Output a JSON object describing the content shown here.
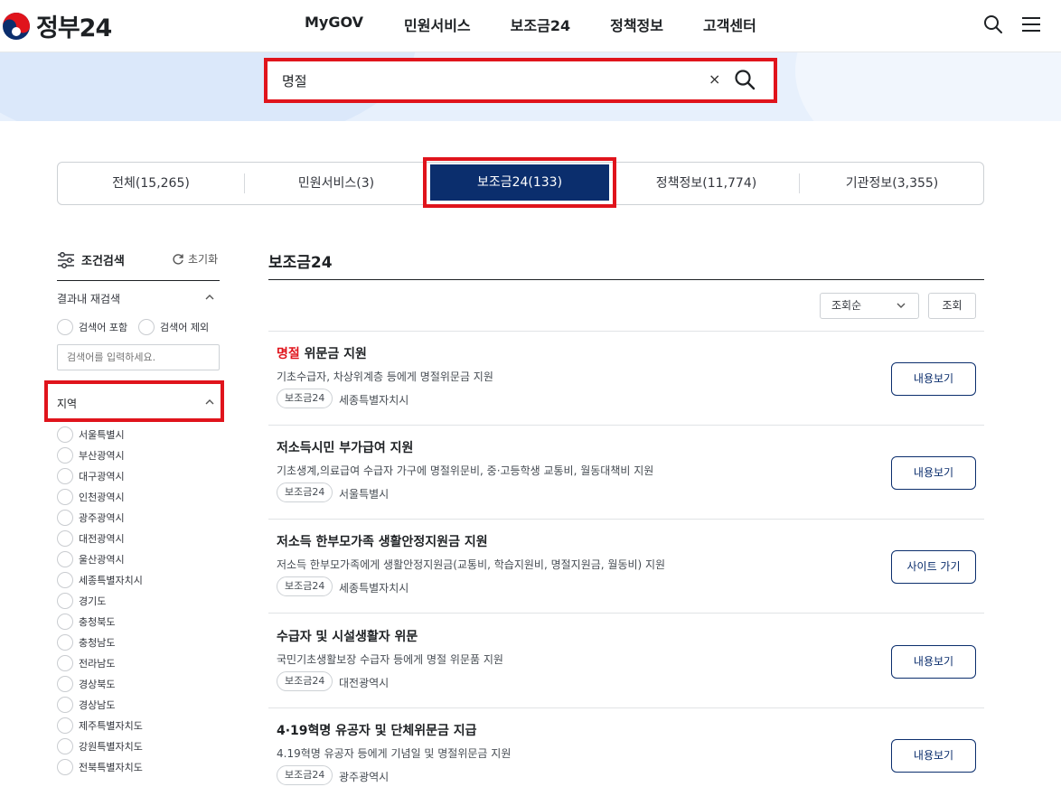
{
  "header": {
    "logo_text": "정부24",
    "nav": [
      "MyGOV",
      "민원서비스",
      "보조금24",
      "정책정보",
      "고객센터"
    ]
  },
  "search": {
    "value": "명절",
    "clear_label": "×"
  },
  "tabs": [
    {
      "label": "전체(15,265)"
    },
    {
      "label": "민원서비스(3)"
    },
    {
      "label": "보조금24(133)",
      "active": true
    },
    {
      "label": "정책정보(11,774)"
    },
    {
      "label": "기관정보(3,355)"
    }
  ],
  "sidebar": {
    "title": "조건검색",
    "reset_label": "초기화",
    "research_label": "결과내 재검색",
    "include_label": "검색어 포함",
    "exclude_label": "검색어 제외",
    "search_placeholder": "검색어를 입력하세요.",
    "region_label": "지역",
    "regions": [
      "서울특별시",
      "부산광역시",
      "대구광역시",
      "인천광역시",
      "광주광역시",
      "대전광역시",
      "울산광역시",
      "세종특별자치시",
      "경기도",
      "충청북도",
      "충청남도",
      "전라남도",
      "경상북도",
      "경상남도",
      "제주특별자치도",
      "강원특별자치도",
      "전북특별자치도"
    ]
  },
  "main": {
    "title": "보조금24",
    "sort_value": "조회순",
    "sort_button": "조회",
    "results": [
      {
        "title_highlight": "명절",
        "title_rest": " 위문금 지원",
        "desc": "기초수급자, 차상위계층 등에게 명절위문금 지원",
        "tag": "보조금24",
        "region": "세종특별자치시",
        "button": "내용보기"
      },
      {
        "title_highlight": "",
        "title_rest": "저소득시민 부가급여 지원",
        "desc": "기초생계,의료급여 수급자 가구에 명절위문비, 중·고등학생 교통비, 월동대책비 지원",
        "tag": "보조금24",
        "region": "서울특별시",
        "button": "내용보기"
      },
      {
        "title_highlight": "",
        "title_rest": "저소득 한부모가족 생활안정지원금 지원",
        "desc": "저소득 한부모가족에게 생활안정지원금(교통비, 학습지원비, 명절지원금, 월동비) 지원",
        "tag": "보조금24",
        "region": "세종특별자치시",
        "button": "사이트 가기"
      },
      {
        "title_highlight": "",
        "title_rest": "수급자 및 시설생활자 위문",
        "desc": "국민기초생활보장 수급자 등에게 명절 위문품 지원",
        "tag": "보조금24",
        "region": "대전광역시",
        "button": "내용보기"
      },
      {
        "title_highlight": "",
        "title_rest": "4·19혁명 유공자 및 단체위문금 지급",
        "desc": "4.19혁명 유공자 등에게 기념일 및 명절위문금 지원",
        "tag": "보조금24",
        "region": "광주광역시",
        "button": "내용보기"
      }
    ]
  },
  "colors": {
    "primary_navy": "#0b2e6d",
    "highlight_red": "#e0141c",
    "banner_bg": "#e7f0fc"
  }
}
